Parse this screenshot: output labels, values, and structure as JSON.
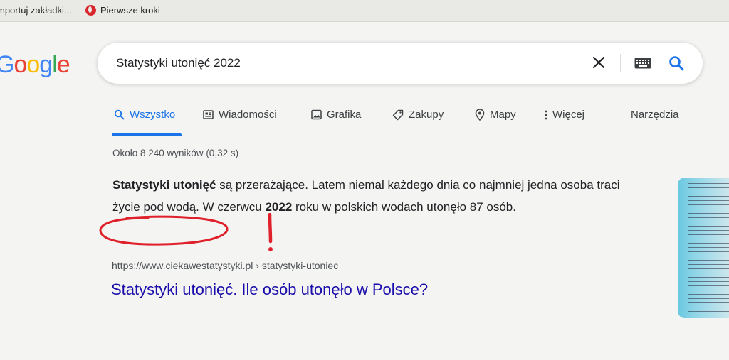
{
  "bookmarks": {
    "item1": "mportuj zakładki...",
    "item2": "Pierwsze kroki"
  },
  "logo": {
    "letters": [
      "o",
      "o",
      "g",
      "l",
      "e",
      ""
    ],
    "text": "oogle"
  },
  "search": {
    "query": "Statystyki utonięć 2022"
  },
  "tabs": {
    "all": "Wszystko",
    "news": "Wiadomości",
    "images": "Grafika",
    "shopping": "Zakupy",
    "maps": "Mapy",
    "more": "Więcej",
    "tools": "Narzędzia"
  },
  "results": {
    "stats": "Około 8 240 wyników (0,32 s)",
    "snippet_bold1": "Statystyki utonięć",
    "snippet_text1": " są przerażające. Latem niemal każdego dnia co najmniej jedna osoba traci życie pod wodą. W czerwcu ",
    "snippet_bold2": "2022",
    "snippet_text2": " roku w polskich wodach utonęło 87 osób.",
    "url": "https://www.ciekawestatystyki.pl › statystyki-utoniec",
    "title": "Statystyki utonięć. Ile osób utonęło w Polsce?"
  },
  "annotations": {
    "exclamation": "!"
  },
  "colors": {
    "accent": "#1a73e8",
    "link": "#1a0dab",
    "annotation": "#e0202a"
  },
  "icons": [
    "opera-icon",
    "clear-icon",
    "keyboard-icon",
    "search-icon",
    "magnifier-tab-icon",
    "news-icon",
    "image-icon",
    "tag-icon",
    "map-pin-icon",
    "more-dots-icon"
  ]
}
